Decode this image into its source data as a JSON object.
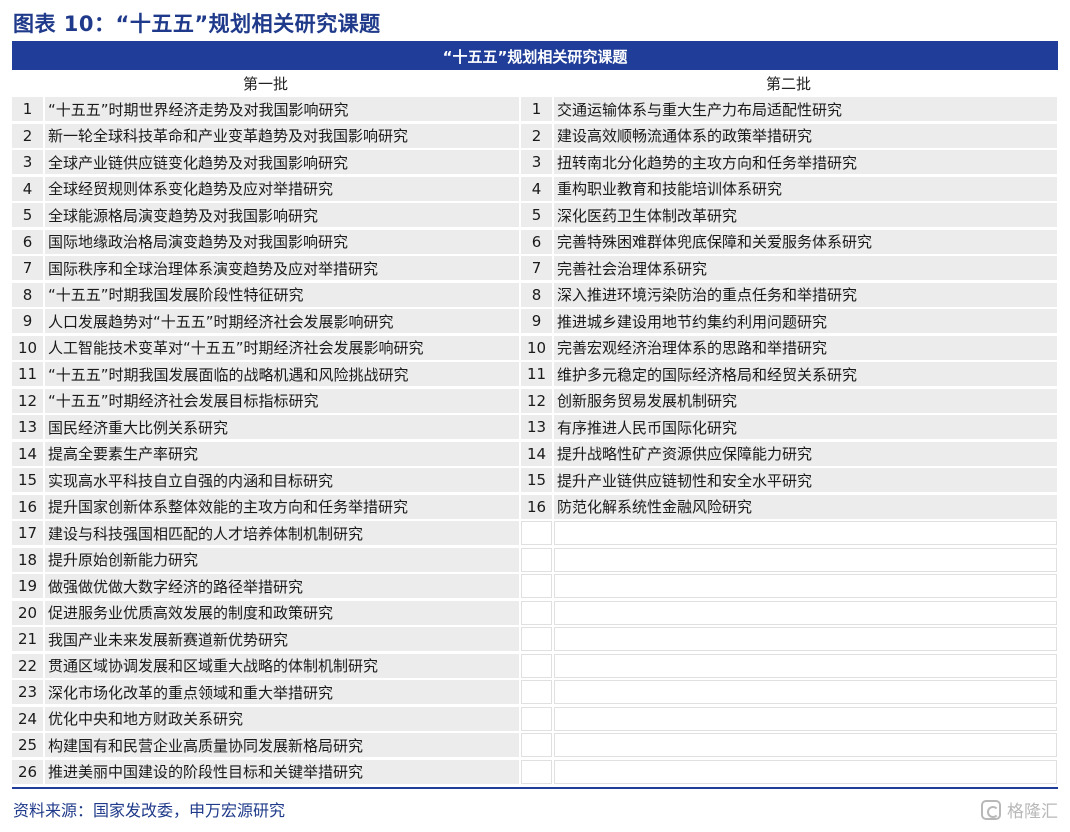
{
  "figure_title": "图表 10：“十五五”规划相关研究课题",
  "table": {
    "header": "“十五五”规划相关研究课题",
    "col_left": "第一批",
    "col_right": "第二批",
    "first_batch": [
      {
        "n": "1",
        "t": "“十五五”时期世界经济走势及对我国影响研究"
      },
      {
        "n": "2",
        "t": "新一轮全球科技革命和产业变革趋势及对我国影响研究"
      },
      {
        "n": "3",
        "t": "全球产业链供应链变化趋势及对我国影响研究"
      },
      {
        "n": "4",
        "t": "全球经贸规则体系变化趋势及应对举措研究"
      },
      {
        "n": "5",
        "t": "全球能源格局演变趋势及对我国影响研究"
      },
      {
        "n": "6",
        "t": "国际地缘政治格局演变趋势及对我国影响研究"
      },
      {
        "n": "7",
        "t": "国际秩序和全球治理体系演变趋势及应对举措研究"
      },
      {
        "n": "8",
        "t": "“十五五”时期我国发展阶段性特征研究"
      },
      {
        "n": "9",
        "t": "人口发展趋势对“十五五”时期经济社会发展影响研究"
      },
      {
        "n": "10",
        "t": "人工智能技术变革对“十五五”时期经济社会发展影响研究"
      },
      {
        "n": "11",
        "t": "“十五五”时期我国发展面临的战略机遇和风险挑战研究"
      },
      {
        "n": "12",
        "t": "“十五五”时期经济社会发展目标指标研究"
      },
      {
        "n": "13",
        "t": "国民经济重大比例关系研究"
      },
      {
        "n": "14",
        "t": "提高全要素生产率研究"
      },
      {
        "n": "15",
        "t": "实现高水平科技自立自强的内涵和目标研究"
      },
      {
        "n": "16",
        "t": "提升国家创新体系整体效能的主攻方向和任务举措研究"
      },
      {
        "n": "17",
        "t": "建设与科技强国相匹配的人才培养体制机制研究"
      },
      {
        "n": "18",
        "t": "提升原始创新能力研究"
      },
      {
        "n": "19",
        "t": "做强做优做大数字经济的路径举措研究"
      },
      {
        "n": "20",
        "t": "促进服务业优质高效发展的制度和政策研究"
      },
      {
        "n": "21",
        "t": "我国产业未来发展新赛道新优势研究"
      },
      {
        "n": "22",
        "t": "贯通区域协调发展和区域重大战略的体制机制研究"
      },
      {
        "n": "23",
        "t": "深化市场化改革的重点领域和重大举措研究"
      },
      {
        "n": "24",
        "t": "优化中央和地方财政关系研究"
      },
      {
        "n": "25",
        "t": "构建国有和民营企业高质量协同发展新格局研究"
      },
      {
        "n": "26",
        "t": "推进美丽中国建设的阶段性目标和关键举措研究"
      }
    ],
    "second_batch": [
      {
        "n": "1",
        "t": "交通运输体系与重大生产力布局适配性研究"
      },
      {
        "n": "2",
        "t": "建设高效顺畅流通体系的政策举措研究"
      },
      {
        "n": "3",
        "t": "扭转南北分化趋势的主攻方向和任务举措研究"
      },
      {
        "n": "4",
        "t": "重构职业教育和技能培训体系研究"
      },
      {
        "n": "5",
        "t": "深化医药卫生体制改革研究"
      },
      {
        "n": "6",
        "t": "完善特殊困难群体兜底保障和关爱服务体系研究"
      },
      {
        "n": "7",
        "t": "完善社会治理体系研究"
      },
      {
        "n": "8",
        "t": "深入推进环境污染防治的重点任务和举措研究"
      },
      {
        "n": "9",
        "t": "推进城乡建设用地节约集约利用问题研究"
      },
      {
        "n": "10",
        "t": "完善宏观经济治理体系的思路和举措研究"
      },
      {
        "n": "11",
        "t": "维护多元稳定的国际经济格局和经贸关系研究"
      },
      {
        "n": "12",
        "t": "创新服务贸易发展机制研究"
      },
      {
        "n": "13",
        "t": "有序推进人民币国际化研究"
      },
      {
        "n": "14",
        "t": "提升战略性矿产资源供应保障能力研究"
      },
      {
        "n": "15",
        "t": "提升产业链供应链韧性和安全水平研究"
      },
      {
        "n": "16",
        "t": "防范化解系统性金融风险研究"
      }
    ]
  },
  "source": "资料来源：国家发改委，申万宏源研究",
  "watermark": "格隆汇"
}
